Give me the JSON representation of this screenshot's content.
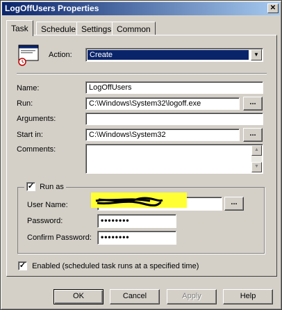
{
  "window": {
    "title": "LogOffUsers Properties",
    "close_glyph": "✕"
  },
  "tabs": [
    {
      "label": "Task",
      "active": true
    },
    {
      "label": "Schedule",
      "active": false
    },
    {
      "label": "Settings",
      "active": false
    },
    {
      "label": "Common",
      "active": false
    }
  ],
  "task": {
    "icon": "scheduled-task-icon",
    "action_label": "Action:",
    "action_value": "Create",
    "name_label": "Name:",
    "name_value": "LogOffUsers",
    "run_label": "Run:",
    "run_value": "C:\\Windows\\System32\\logoff.exe",
    "arguments_label": "Arguments:",
    "arguments_value": "",
    "startin_label": "Start in:",
    "startin_value": "C:\\Windows\\System32",
    "comments_label": "Comments:",
    "comments_value": "",
    "browse_label": "...",
    "runas": {
      "label": "Run as",
      "checked": true,
      "username_label": "User Name:",
      "password_label": "Password:",
      "password_value": "••••••••",
      "confirm_label": "Confirm Password:",
      "confirm_value": "••••••••"
    },
    "enabled_label": "Enabled (scheduled task runs at a specified time)",
    "enabled_checked": true
  },
  "buttons": {
    "ok": "OK",
    "cancel": "Cancel",
    "apply": "Apply",
    "help": "Help"
  },
  "colors": {
    "title_start": "#0a246a",
    "title_end": "#a6caf0",
    "redaction": "#ffff33",
    "dialog_bg": "#d4d0c8"
  }
}
